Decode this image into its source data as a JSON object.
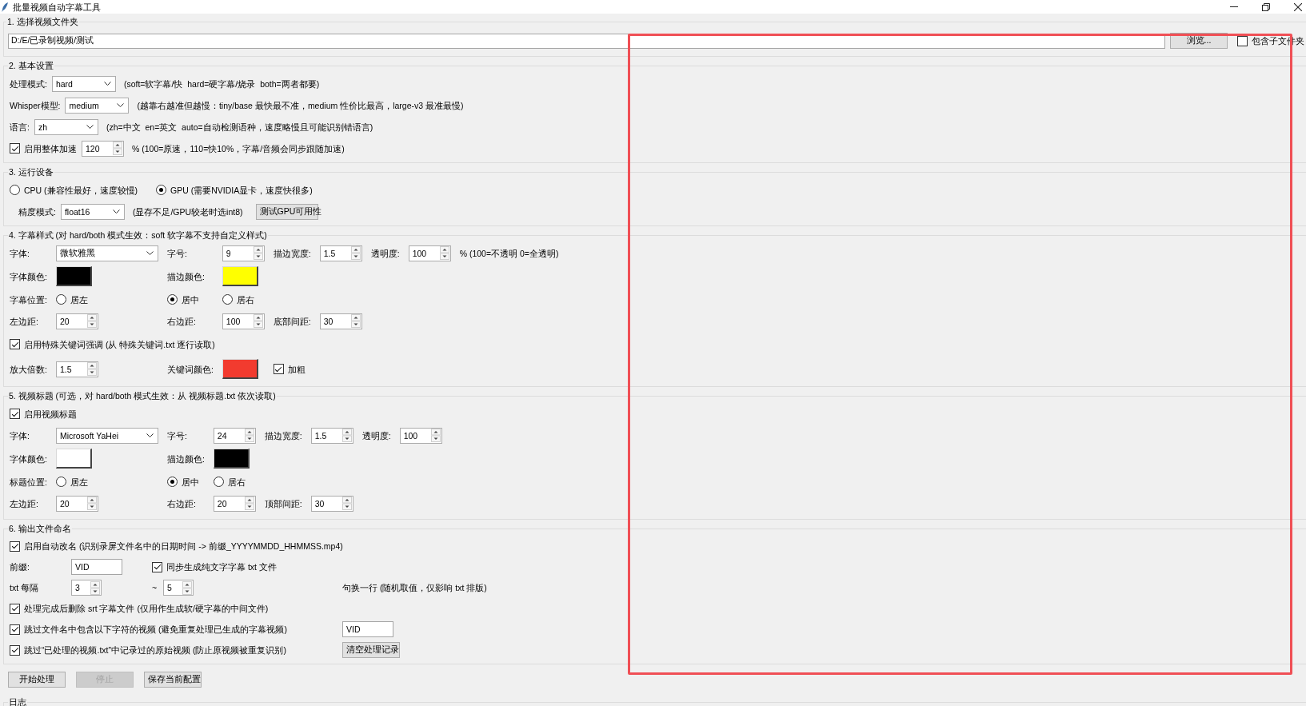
{
  "window": {
    "title": "批量视频自动字幕工具"
  },
  "sections": [
    {
      "kind": "folder",
      "title": "1. 选择视频文件夹",
      "rows": [
        {
          "items": [
            {
              "kind": "path",
              "value": "D:/E/已录制视频/测试"
            },
            {
              "kind": "button",
              "label": "浏览..."
            },
            {
              "kind": "check",
              "label": "包含子文件夹",
              "checked": false
            }
          ]
        }
      ]
    },
    {
      "kind": "basic",
      "title": "2. 基本设置",
      "rows": [
        {
          "items": [
            {
              "kind": "label",
              "text": "处理模式:"
            },
            {
              "kind": "combo",
              "value": "hard"
            },
            {
              "kind": "hint",
              "text": "(soft=软字幕/快  hard=硬字幕/烧录  both=两者都要)"
            }
          ]
        },
        {
          "items": [
            {
              "kind": "label",
              "text": "Whisper模型:"
            },
            {
              "kind": "combo",
              "value": "medium"
            },
            {
              "kind": "hint",
              "text": "(越靠右越准但越慢：tiny/base 最快最不准，medium 性价比最高，large-v3 最准最慢)"
            }
          ]
        },
        {
          "items": [
            {
              "kind": "label",
              "text": "语言:"
            },
            {
              "kind": "combo",
              "value": "zh"
            },
            {
              "kind": "hint",
              "text": "(zh=中文  en=英文  auto=自动检测语种，速度略慢且可能识别错语言)"
            }
          ]
        },
        {
          "items": [
            {
              "kind": "check",
              "label": "启用整体加速",
              "checked": true
            },
            {
              "kind": "spin",
              "value": "120"
            },
            {
              "kind": "hint",
              "text": "% (100=原速，110=快10%，字幕/音频会同步跟随加速)"
            }
          ]
        }
      ]
    },
    {
      "kind": "device",
      "title": "3. 运行设备",
      "rows": [
        {
          "items": [
            {
              "kind": "radio",
              "label": "CPU (兼容性最好，速度较慢)",
              "selected": false
            },
            {
              "kind": "radio",
              "label": "GPU (需要NVIDIA显卡，速度快很多)",
              "selected": true
            }
          ]
        },
        {
          "items": [
            {
              "kind": "label",
              "text": "精度模式:"
            },
            {
              "kind": "combo",
              "value": "float16"
            },
            {
              "kind": "hint",
              "text": "(显存不足/GPU较老时选int8)"
            },
            {
              "kind": "button",
              "label": "测试GPU可用性"
            }
          ]
        }
      ]
    },
    {
      "kind": "grid",
      "title": "4. 字幕样式 (对 hard/both 模式生效：soft 软字幕不支持自定义样式)",
      "rows": [
        {
          "items": [
            {
              "kind": "label",
              "text": "字体:"
            },
            {
              "kind": "combo",
              "value": "微软雅黑"
            },
            {
              "kind": "label",
              "text": "字号:"
            },
            {
              "kind": "spin",
              "value": "9"
            },
            {
              "kind": "label",
              "text": "描边宽度:"
            },
            {
              "kind": "spin",
              "value": "1.5"
            },
            {
              "kind": "label",
              "text": "透明度:"
            },
            {
              "kind": "spin",
              "value": "100"
            },
            {
              "kind": "hint",
              "text": "% (100=不透明 0=全透明)"
            }
          ]
        },
        {
          "items": [
            {
              "kind": "label",
              "text": "字体颜色:"
            },
            {
              "kind": "swatch",
              "color": "#000000"
            },
            {
              "kind": "label",
              "text": "描边颜色:"
            },
            {
              "kind": "swatch",
              "color": "#ffff00"
            }
          ]
        },
        {
          "items": [
            {
              "kind": "label",
              "text": "字幕位置:"
            },
            {
              "kind": "radio",
              "label": "居左",
              "selected": false
            },
            {
              "kind": "radio",
              "label": "居中",
              "selected": true
            },
            {
              "kind": "radio",
              "label": "居右",
              "selected": false
            }
          ]
        },
        {
          "items": [
            {
              "kind": "label",
              "text": "左边距:"
            },
            {
              "kind": "spin",
              "value": "20"
            },
            {
              "kind": "label",
              "text": "右边距:"
            },
            {
              "kind": "spin",
              "value": "100"
            },
            {
              "kind": "label",
              "text": "底部间距:"
            },
            {
              "kind": "spin",
              "value": "30"
            }
          ]
        },
        {
          "items": [
            {
              "kind": "check",
              "label": "启用特殊关键词强调 (从 特殊关键词.txt 逐行读取)",
              "checked": true
            }
          ]
        },
        {
          "items": [
            {
              "kind": "label",
              "text": "放大倍数:"
            },
            {
              "kind": "spin",
              "value": "1.5"
            },
            {
              "kind": "label",
              "text": "关键词颜色:"
            },
            {
              "kind": "swatch",
              "color": "#f23b2f"
            },
            {
              "kind": "check",
              "label": "加粗",
              "checked": true
            }
          ]
        }
      ]
    },
    {
      "kind": "grid",
      "title": "5. 视频标题 (可选，对 hard/both 模式生效：从 视频标题.txt 依次读取)",
      "rows": [
        {
          "items": [
            {
              "kind": "check",
              "label": "启用视频标题",
              "checked": true
            }
          ]
        },
        {
          "items": [
            {
              "kind": "label",
              "text": "字体:"
            },
            {
              "kind": "combo",
              "value": "Microsoft YaHei"
            },
            {
              "kind": "label",
              "text": "字号:"
            },
            {
              "kind": "spin",
              "value": "24"
            },
            {
              "kind": "label",
              "text": "描边宽度:"
            },
            {
              "kind": "spin",
              "value": "1.5"
            },
            {
              "kind": "label",
              "text": "透明度:"
            },
            {
              "kind": "spin",
              "value": "100"
            }
          ]
        },
        {
          "items": [
            {
              "kind": "label",
              "text": "字体颜色:"
            },
            {
              "kind": "swatch",
              "color": "#ffffff"
            },
            {
              "kind": "label",
              "text": "描边颜色:"
            },
            {
              "kind": "swatch",
              "color": "#000000"
            }
          ]
        },
        {
          "items": [
            {
              "kind": "label",
              "text": "标题位置:"
            },
            {
              "kind": "radio",
              "label": "居左",
              "selected": false
            },
            {
              "kind": "radio",
              "label": "居中",
              "selected": true
            },
            {
              "kind": "radio",
              "label": "居右",
              "selected": false
            }
          ]
        },
        {
          "items": [
            {
              "kind": "label",
              "text": "左边距:"
            },
            {
              "kind": "spin",
              "value": "20"
            },
            {
              "kind": "label",
              "text": "右边距:"
            },
            {
              "kind": "spin",
              "value": "20"
            },
            {
              "kind": "label",
              "text": "顶部间距:"
            },
            {
              "kind": "spin",
              "value": "30"
            }
          ]
        }
      ]
    },
    {
      "kind": "naming",
      "title": "6. 输出文件命名",
      "rows": [
        {
          "items": [
            {
              "kind": "check",
              "label": "启用自动改名 (识别录屏文件名中的日期时间 -> 前缀_YYYYMMDD_HHMMSS.mp4)",
              "checked": true
            }
          ]
        },
        {
          "items": [
            {
              "kind": "label",
              "text": "前缀:"
            },
            {
              "kind": "entry",
              "value": "VID"
            },
            {
              "kind": "check",
              "label": "同步生成纯文字字幕 txt 文件",
              "checked": true
            }
          ]
        },
        {
          "items": [
            {
              "kind": "label",
              "text": "txt 每隔"
            },
            {
              "kind": "spin",
              "value": "3"
            },
            {
              "kind": "label",
              "text": "~"
            },
            {
              "kind": "spin",
              "value": "5"
            },
            {
              "kind": "hint",
              "text": "句换一行 (随机取值，仅影响 txt 排版)"
            }
          ]
        },
        {
          "items": [
            {
              "kind": "check",
              "label": "处理完成后删除 srt 字幕文件 (仅用作生成软/硬字幕的中间文件)",
              "checked": true
            }
          ]
        },
        {
          "items": [
            {
              "kind": "check",
              "label": "跳过文件名中包含以下字符的视频 (避免重复处理已生成的字幕视频)",
              "checked": true
            },
            {
              "kind": "entry",
              "value": "VID"
            }
          ]
        },
        {
          "items": [
            {
              "kind": "check",
              "label": "跳过“已处理的视频.txt”中记录过的原始视频 (防止原视频被重复识别)",
              "checked": true
            },
            {
              "kind": "button",
              "label": "清空处理记录"
            }
          ]
        }
      ]
    }
  ],
  "actions": [
    {
      "label": "开始处理",
      "disabled": false
    },
    {
      "label": "停止",
      "disabled": true
    },
    {
      "label": "保存当前配置",
      "disabled": false
    }
  ],
  "log": {
    "title": "日志"
  },
  "annotations": [
    {
      "kind": "highlight-rectangle"
    }
  ]
}
